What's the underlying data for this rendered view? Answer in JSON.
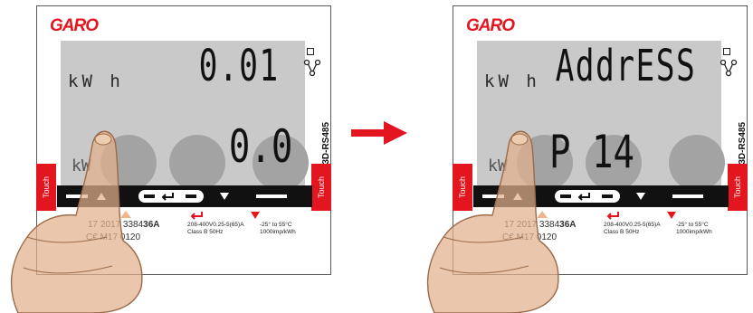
{
  "brand": "GARO",
  "device_model": "GNM3D-RS485",
  "touch_label": "Touch",
  "unit_label": "kW h",
  "specs": {
    "serial_prefix": "17 2017 3384",
    "serial_suffix": "36A",
    "mid_code": "M17 0120",
    "voltage": "208-400V",
    "current": "0.25-5(65)A",
    "class_freq": "Class B 50Hz",
    "temp_range": "-25° to 55°C",
    "imp": "1000imp/kWh"
  },
  "panels": [
    {
      "main_display": "0.01",
      "sub_display": "0.0",
      "sub_left": "",
      "small_label": "kW"
    },
    {
      "main_display": "AddrESS",
      "sub_display": "",
      "sub_left": "P 14",
      "small_label": "kW"
    }
  ],
  "colors": {
    "brand_red": "#e3151f",
    "lcd_bg": "#c9c9c9",
    "circle": "#a3a3a3",
    "arrow": "#e3151f"
  },
  "icons": [
    "network-icon",
    "square-icon",
    "enter-icon",
    "triangle-up-icon",
    "triangle-down-icon",
    "arrow-right-icon",
    "pointing-hand-icon"
  ]
}
